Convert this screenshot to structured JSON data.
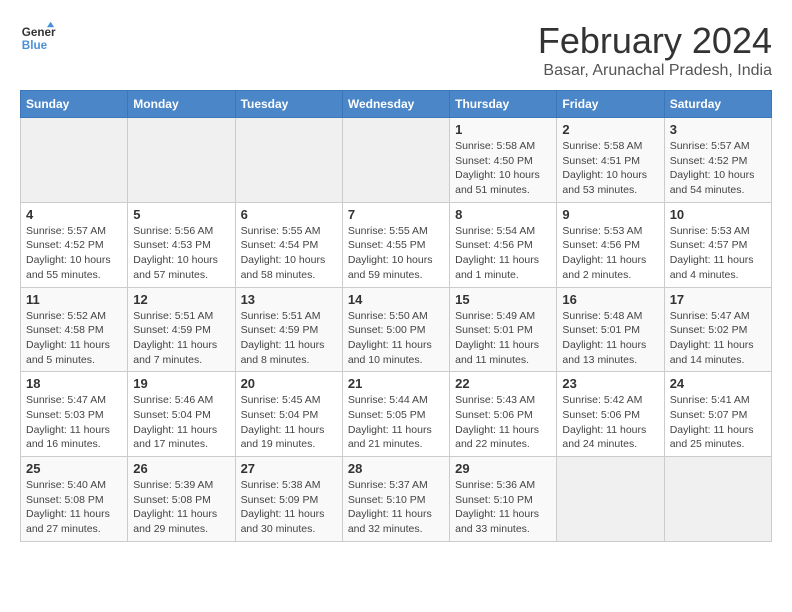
{
  "logo": {
    "line1": "General",
    "line2": "Blue"
  },
  "title": "February 2024",
  "subtitle": "Basar, Arunachal Pradesh, India",
  "days_of_week": [
    "Sunday",
    "Monday",
    "Tuesday",
    "Wednesday",
    "Thursday",
    "Friday",
    "Saturday"
  ],
  "weeks": [
    [
      {
        "day": "",
        "info": ""
      },
      {
        "day": "",
        "info": ""
      },
      {
        "day": "",
        "info": ""
      },
      {
        "day": "",
        "info": ""
      },
      {
        "day": "1",
        "info": "Sunrise: 5:58 AM\nSunset: 4:50 PM\nDaylight: 10 hours\nand 51 minutes."
      },
      {
        "day": "2",
        "info": "Sunrise: 5:58 AM\nSunset: 4:51 PM\nDaylight: 10 hours\nand 53 minutes."
      },
      {
        "day": "3",
        "info": "Sunrise: 5:57 AM\nSunset: 4:52 PM\nDaylight: 10 hours\nand 54 minutes."
      }
    ],
    [
      {
        "day": "4",
        "info": "Sunrise: 5:57 AM\nSunset: 4:52 PM\nDaylight: 10 hours\nand 55 minutes."
      },
      {
        "day": "5",
        "info": "Sunrise: 5:56 AM\nSunset: 4:53 PM\nDaylight: 10 hours\nand 57 minutes."
      },
      {
        "day": "6",
        "info": "Sunrise: 5:55 AM\nSunset: 4:54 PM\nDaylight: 10 hours\nand 58 minutes."
      },
      {
        "day": "7",
        "info": "Sunrise: 5:55 AM\nSunset: 4:55 PM\nDaylight: 10 hours\nand 59 minutes."
      },
      {
        "day": "8",
        "info": "Sunrise: 5:54 AM\nSunset: 4:56 PM\nDaylight: 11 hours\nand 1 minute."
      },
      {
        "day": "9",
        "info": "Sunrise: 5:53 AM\nSunset: 4:56 PM\nDaylight: 11 hours\nand 2 minutes."
      },
      {
        "day": "10",
        "info": "Sunrise: 5:53 AM\nSunset: 4:57 PM\nDaylight: 11 hours\nand 4 minutes."
      }
    ],
    [
      {
        "day": "11",
        "info": "Sunrise: 5:52 AM\nSunset: 4:58 PM\nDaylight: 11 hours\nand 5 minutes."
      },
      {
        "day": "12",
        "info": "Sunrise: 5:51 AM\nSunset: 4:59 PM\nDaylight: 11 hours\nand 7 minutes."
      },
      {
        "day": "13",
        "info": "Sunrise: 5:51 AM\nSunset: 4:59 PM\nDaylight: 11 hours\nand 8 minutes."
      },
      {
        "day": "14",
        "info": "Sunrise: 5:50 AM\nSunset: 5:00 PM\nDaylight: 11 hours\nand 10 minutes."
      },
      {
        "day": "15",
        "info": "Sunrise: 5:49 AM\nSunset: 5:01 PM\nDaylight: 11 hours\nand 11 minutes."
      },
      {
        "day": "16",
        "info": "Sunrise: 5:48 AM\nSunset: 5:01 PM\nDaylight: 11 hours\nand 13 minutes."
      },
      {
        "day": "17",
        "info": "Sunrise: 5:47 AM\nSunset: 5:02 PM\nDaylight: 11 hours\nand 14 minutes."
      }
    ],
    [
      {
        "day": "18",
        "info": "Sunrise: 5:47 AM\nSunset: 5:03 PM\nDaylight: 11 hours\nand 16 minutes."
      },
      {
        "day": "19",
        "info": "Sunrise: 5:46 AM\nSunset: 5:04 PM\nDaylight: 11 hours\nand 17 minutes."
      },
      {
        "day": "20",
        "info": "Sunrise: 5:45 AM\nSunset: 5:04 PM\nDaylight: 11 hours\nand 19 minutes."
      },
      {
        "day": "21",
        "info": "Sunrise: 5:44 AM\nSunset: 5:05 PM\nDaylight: 11 hours\nand 21 minutes."
      },
      {
        "day": "22",
        "info": "Sunrise: 5:43 AM\nSunset: 5:06 PM\nDaylight: 11 hours\nand 22 minutes."
      },
      {
        "day": "23",
        "info": "Sunrise: 5:42 AM\nSunset: 5:06 PM\nDaylight: 11 hours\nand 24 minutes."
      },
      {
        "day": "24",
        "info": "Sunrise: 5:41 AM\nSunset: 5:07 PM\nDaylight: 11 hours\nand 25 minutes."
      }
    ],
    [
      {
        "day": "25",
        "info": "Sunrise: 5:40 AM\nSunset: 5:08 PM\nDaylight: 11 hours\nand 27 minutes."
      },
      {
        "day": "26",
        "info": "Sunrise: 5:39 AM\nSunset: 5:08 PM\nDaylight: 11 hours\nand 29 minutes."
      },
      {
        "day": "27",
        "info": "Sunrise: 5:38 AM\nSunset: 5:09 PM\nDaylight: 11 hours\nand 30 minutes."
      },
      {
        "day": "28",
        "info": "Sunrise: 5:37 AM\nSunset: 5:10 PM\nDaylight: 11 hours\nand 32 minutes."
      },
      {
        "day": "29",
        "info": "Sunrise: 5:36 AM\nSunset: 5:10 PM\nDaylight: 11 hours\nand 33 minutes."
      },
      {
        "day": "",
        "info": ""
      },
      {
        "day": "",
        "info": ""
      }
    ]
  ]
}
